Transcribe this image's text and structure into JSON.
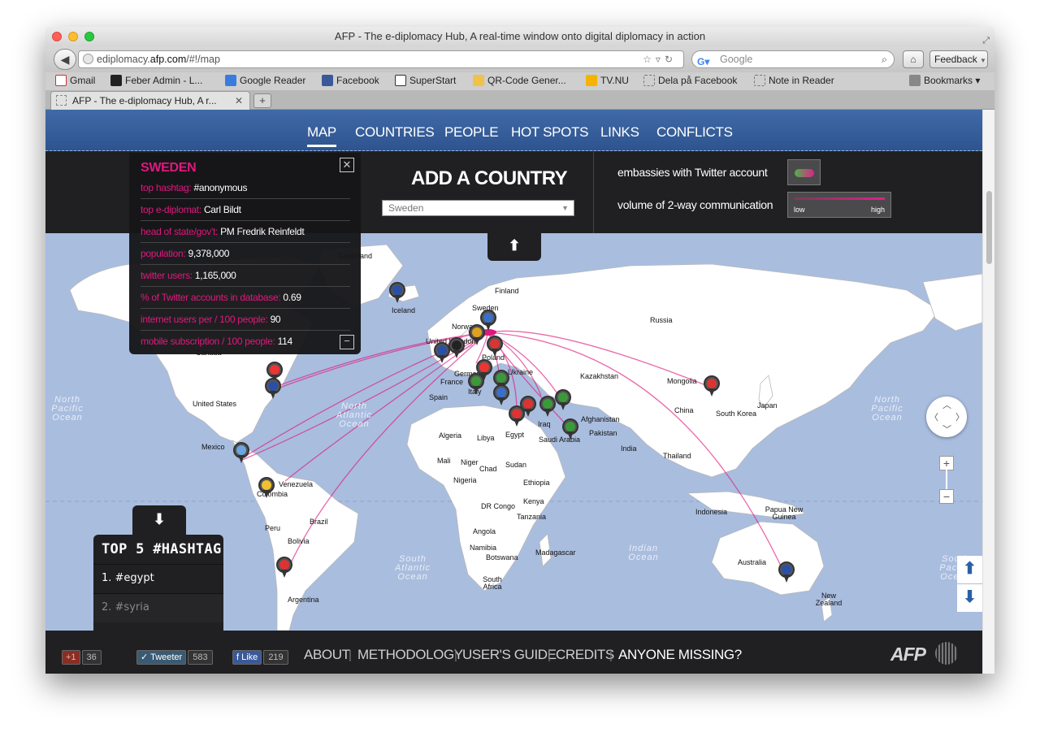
{
  "browser": {
    "title": "AFP - The e-diplomacy Hub, A real-time window onto digital diplomacy in action",
    "url_domain": "ediplomacy.",
    "url_host": "afp.com",
    "url_path": "/#!/map",
    "search_placeholder": "Google",
    "feedback_label": "Feedback",
    "bookmarks": [
      "Gmail",
      "Feber Admin - L...",
      "Google Reader",
      "Facebook",
      "SuperStart",
      "QR-Code Gener...",
      "TV.NU",
      "Dela på Facebook",
      "Note in Reader"
    ],
    "bookmarks_menu": "Bookmarks",
    "tab_title": "AFP - The e-diplomacy Hub, A r..."
  },
  "nav": {
    "items": [
      "MAP",
      "COUNTRIES",
      "PEOPLE",
      "HOT SPOTS",
      "LINKS",
      "CONFLICTS"
    ],
    "active": "MAP"
  },
  "add_country": {
    "title": "ADD A COUNTRY",
    "selected": "Sweden"
  },
  "legend": {
    "embassies_label": "embassies with Twitter account",
    "volume_label": "volume of 2-way communication",
    "low": "low",
    "high": "high",
    "colors": {
      "accent": "#e0187e",
      "green": "#4db34a"
    }
  },
  "info": {
    "country": "SWEDEN",
    "rows": [
      {
        "k": "top hashtag:",
        "v": "#anonymous"
      },
      {
        "k": "top e-diplomat:",
        "v": "Carl Bildt"
      },
      {
        "k": "head of state/gov't:",
        "v": "PM Fredrik Reinfeldt"
      },
      {
        "k": "population:",
        "v": "9,378,000"
      },
      {
        "k": "twitter users:",
        "v": "1,165,000"
      },
      {
        "k": "% of Twitter accounts in database:",
        "v": "0.69"
      },
      {
        "k": "internet users per / 100 people:",
        "v": "90"
      },
      {
        "k": "mobile subscription / 100 people:",
        "v": "114"
      }
    ]
  },
  "map_labels": {
    "places": [
      "Greenland",
      "Iceland",
      "Finland",
      "Sweden",
      "Norway",
      "United Kingdom",
      "Poland",
      "Ukraine",
      "Germany",
      "France",
      "Spain",
      "Italy",
      "Russia",
      "Kazakhstan",
      "Mongolia",
      "China",
      "Japan",
      "South Korea",
      "Afghanistan",
      "Pakistan",
      "India",
      "Thailand",
      "Iraq",
      "Saudi Arabia",
      "Egypt",
      "Libya",
      "Algeria",
      "Mali",
      "Niger",
      "Chad",
      "Sudan",
      "Ethiopia",
      "Nigeria",
      "Kenya",
      "DR Congo",
      "Tanzania",
      "Angola",
      "Namibia",
      "Botswana",
      "Madagascar",
      "South Africa",
      "United States",
      "Mexico",
      "Canada",
      "Venezuela",
      "Colombia",
      "Peru",
      "Brazil",
      "Bolivia",
      "Argentina",
      "Indonesia",
      "Papua New Guinea",
      "Australia",
      "New Zealand"
    ],
    "oceans": [
      "North Pacific Ocean",
      "North Atlantic Ocean",
      "South Atlantic Ocean",
      "Indian Ocean",
      "North Pacific Ocean",
      "South Pacific Ocean"
    ]
  },
  "hashtags": {
    "title": "TOP 5 #HASHTAG",
    "items": [
      "1. #egypt",
      "2. #syria"
    ]
  },
  "footer": {
    "gplus": "+1",
    "gplus_count": "36",
    "tweet": "Tweeter",
    "tweet_count": "583",
    "like": "Like",
    "like_count": "219",
    "links": [
      "ABOUT",
      "METHODOLOGY",
      "USER'S GUIDE",
      "CREDITS",
      "ANYONE MISSING?"
    ],
    "logo": "AFP"
  }
}
